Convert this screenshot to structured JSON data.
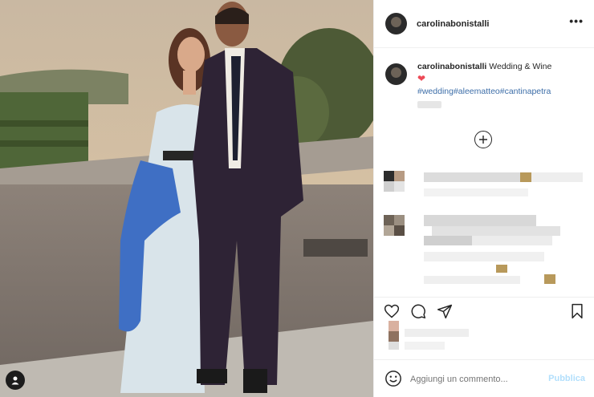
{
  "post": {
    "username": "carolinabonistalli",
    "caption": "Wedding & Wine",
    "caption_emoji": "❤",
    "hashtags": [
      "#wedding",
      "#aleematteo",
      "#cantinapetra"
    ]
  },
  "icons": {
    "more": "more-options-icon",
    "like": "heart-icon",
    "comment": "comment-icon",
    "share": "paper-plane-icon",
    "save": "bookmark-icon",
    "emoji": "emoji-icon",
    "add": "plus-circle-icon",
    "tag_user": "user-tag-icon"
  },
  "comment_box": {
    "placeholder": "Aggiungi un commento...",
    "publish_label": "Pubblica"
  },
  "colors": {
    "link": "#3d6ea8",
    "heart": "#ed4956",
    "publish_disabled": "#b2dffc"
  }
}
